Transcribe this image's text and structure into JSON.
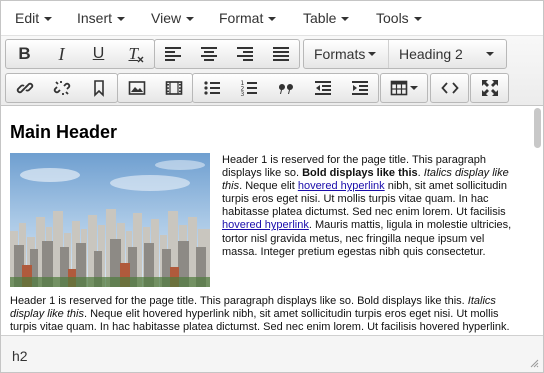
{
  "menubar": {
    "items": [
      "Edit",
      "Insert",
      "View",
      "Format",
      "Table",
      "Tools"
    ]
  },
  "toolbar": {
    "formats_label": "Formats",
    "block_format_value": "Heading 2",
    "row1_icons": [
      "bold-icon",
      "italic-icon",
      "underline-icon",
      "clear-formatting-icon",
      "align-left-icon",
      "align-center-icon",
      "align-right-icon",
      "align-justify-icon"
    ],
    "row2_icons": [
      "link-icon",
      "unlink-icon",
      "bookmark-icon",
      "image-icon",
      "media-icon",
      "bullet-list-icon",
      "numbered-list-icon",
      "blockquote-icon",
      "outdent-icon",
      "indent-icon",
      "table-icon",
      "code-icon",
      "fullscreen-icon"
    ],
    "bold_glyph": "B",
    "italic_glyph": "I",
    "underline_glyph": "U",
    "clear_glyph": "T"
  },
  "content": {
    "heading": "Main Header",
    "para1": {
      "t1": "Header 1 is reserved for the page title. This paragraph displays like so. ",
      "bold": "Bold displays like this",
      "t2": ". ",
      "italic": "Italics display like this",
      "t3": ". Neque elit ",
      "link1": "hovered hyperlink",
      "t4": " nibh, sit amet sollicitudin turpis eros eget nisi. Ut mollis turpis vitae quam. In hac habitasse platea dictumst. Sed nec enim lorem. Ut facilisis ",
      "link2": "hovered hyperlink",
      "t5": ". Mauris mattis, ligula in molestie ultricies, tortor nisl gravida metus, nec fringilla neque ipsum vel massa. Integer pretium egestas nibh quis consectetur."
    },
    "para2": {
      "t1": "Header 1 is reserved for the page title. This paragraph displays like so. Bold displays like this. ",
      "italic": "Italics display like this",
      "t2": ". Neque elit hovered hyperlink nibh, sit amet sollicitudin turpis eros eget nisi. Ut mollis turpis vitae quam. In hac habitasse platea dictumst. Sed nec enim lorem. Ut facilisis hovered hyperlink. Mauris mattis, ligula in molestie ultricies, tortor nisl gravida metus, nec fringilla neque ipsum vel massa."
    }
  },
  "statusbar": {
    "path": "h2"
  },
  "colors": {
    "link": "#1a0dab",
    "toolbar_border": "#b8b8b8"
  }
}
